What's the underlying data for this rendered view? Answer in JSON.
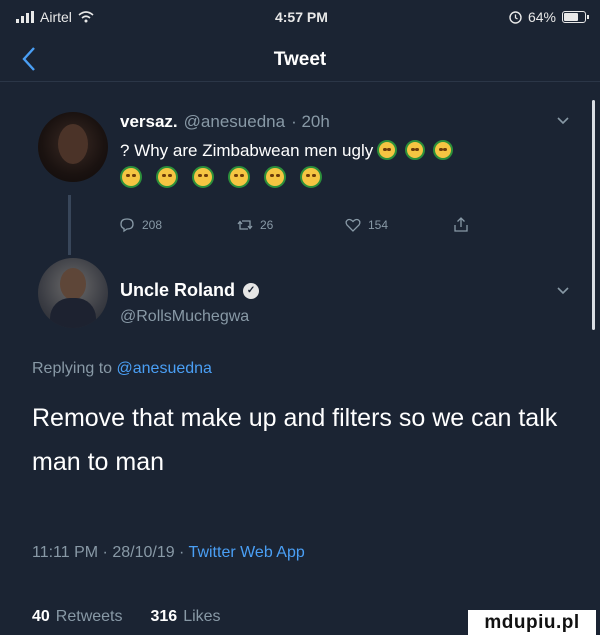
{
  "status_bar": {
    "carrier": "Airtel",
    "time": "4:57 PM",
    "battery": "64%"
  },
  "header": {
    "title": "Tweet"
  },
  "quoted_tweet": {
    "display_name": "versaz.",
    "handle": "@anesuedna",
    "age": "· 20h",
    "text": "? Why are Zimbabwean men ugly",
    "emoji_count_inline": 3,
    "emoji_count_row": 6,
    "reply_count": "208",
    "retweet_count": "26",
    "like_count": "154"
  },
  "main_tweet": {
    "display_name": "Uncle Roland",
    "handle": "@RollsMuchegwa",
    "replying_label": "Replying to",
    "replying_to": "@anesuedna",
    "text": "Remove that make up and filters so we can talk man to man",
    "timestamp": "11:11 PM · 28/10/19 ·",
    "source": "Twitter Web App",
    "retweets_count": "40",
    "retweets_label": "Retweets",
    "likes_count": "316",
    "likes_label": "Likes"
  },
  "watermark": "mdupiu.pl",
  "colors": {
    "background": "#1b2433",
    "accent": "#4a9ff5",
    "muted": "#8899a6"
  }
}
